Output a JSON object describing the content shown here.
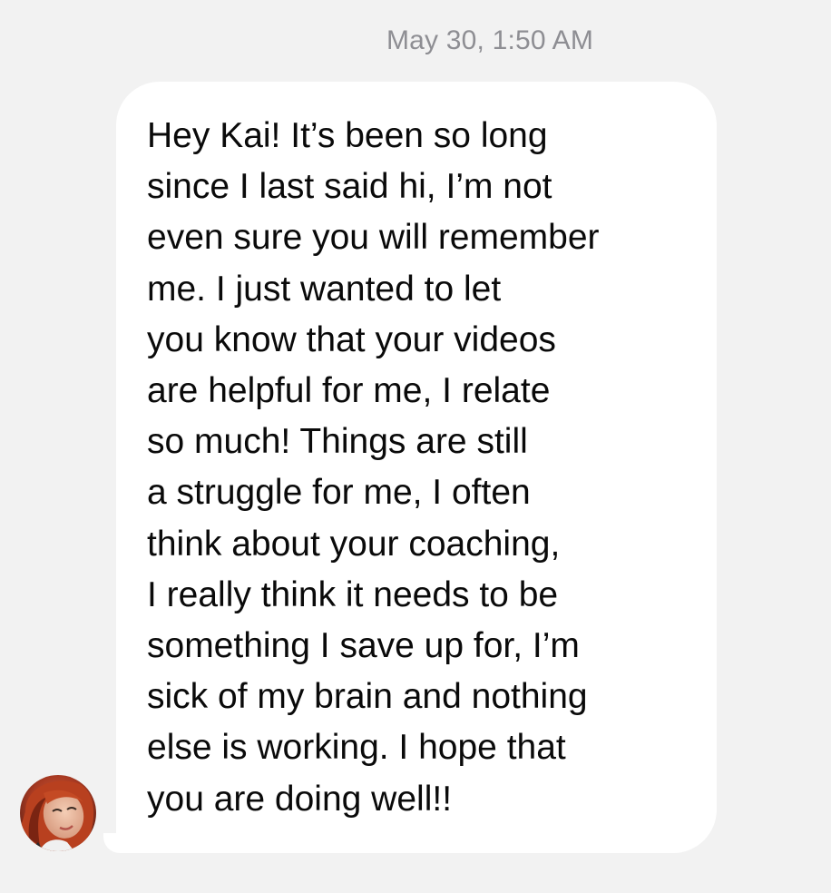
{
  "conversation": {
    "timestamp": "May 30, 1:50 AM",
    "message": {
      "lines": [
        "Hey Kai! It’s been so long",
        "since I last said hi, I’m not",
        "even sure you will remember",
        "me. I just wanted to let",
        "you know that your videos",
        "are helpful for me, I relate",
        "so much! Things are still",
        "a struggle for me, I often",
        "think about your coaching,",
        "I really think it needs to be",
        "something I save up for, I’m",
        "sick of my brain and nothing",
        "else is working. I hope that",
        "you are doing well!!"
      ]
    },
    "sender": {
      "avatar_icon": "user-avatar-photo"
    }
  }
}
